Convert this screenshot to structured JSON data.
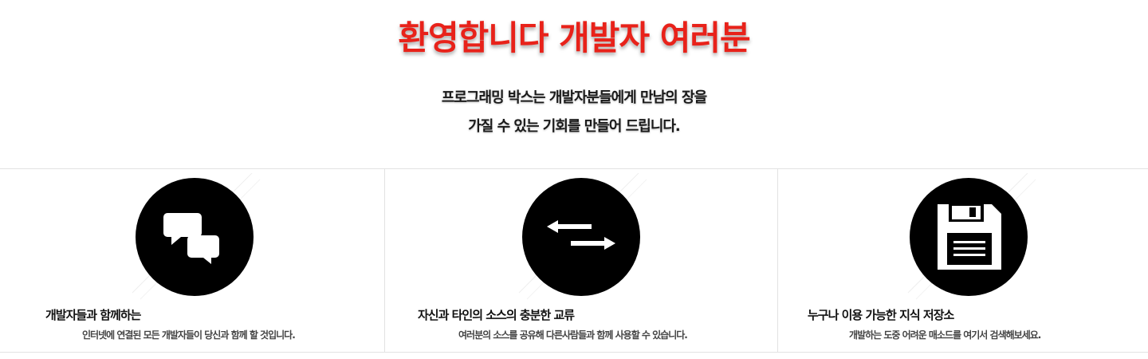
{
  "hero": {
    "title": "환영합니다 개발자 여러분",
    "subtitle_line1": "프로그래밍 박스는 개발자분들에게 만남의 장을",
    "subtitle_line2": "가질 수 있는 기회를 만들어 드립니다."
  },
  "features": [
    {
      "icon": "chat-bubbles-icon",
      "title": "개발자들과 함께하는",
      "description": "인터넷에 연결된 모든 개발자들이 당신과 함께 할 것입니다."
    },
    {
      "icon": "exchange-arrows-icon",
      "title": "자신과 타인의 소스의 충분한 교류",
      "description": "여러분의 소스를 공유해 다른사람들과 함께 사용할 수 있습니다."
    },
    {
      "icon": "floppy-disk-icon",
      "title": "누구나 이용 가능한 지식 저장소",
      "description": "개발하는 도중 어려운 매소드를 여기서 검색해보세요."
    }
  ],
  "colors": {
    "title_red": "#e8221a",
    "icon_circle": "#000000",
    "divider": "#e2e2e2"
  }
}
